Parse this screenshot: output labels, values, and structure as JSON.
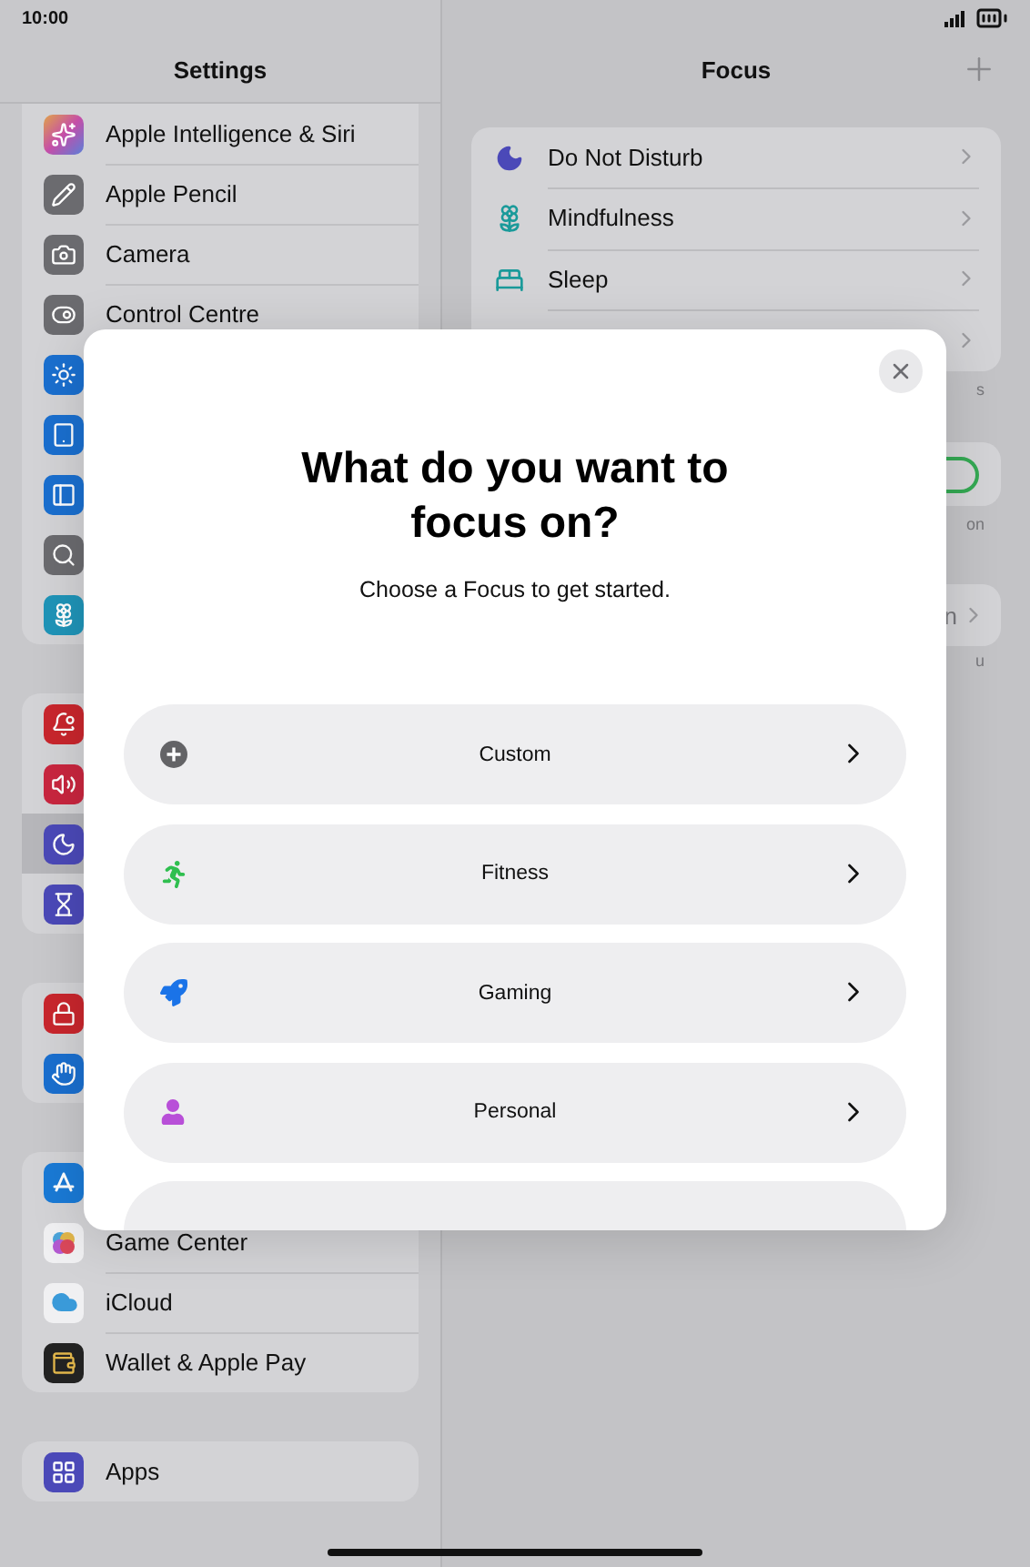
{
  "status_bar": {
    "time": "10:00"
  },
  "sidebar": {
    "title": "Settings",
    "groups": [
      {
        "items": [
          {
            "label": "Apple Intelligence & Siri",
            "selected": false
          },
          {
            "label": "Apple Pencil",
            "selected": false
          },
          {
            "label": "Camera",
            "selected": false
          },
          {
            "label": "Control Centre",
            "selected": false
          },
          {
            "selected": false
          },
          {
            "selected": false
          },
          {
            "selected": false
          },
          {
            "selected": false
          },
          {
            "selected": false
          }
        ]
      },
      {
        "items": [
          {
            "selected": false
          },
          {
            "selected": false
          },
          {
            "selected": true
          },
          {
            "selected": false
          }
        ]
      },
      {
        "items": [
          {
            "selected": false
          },
          {
            "selected": false
          }
        ]
      },
      {
        "items": [
          {
            "selected": false
          },
          {
            "label": "Game Center",
            "selected": false
          },
          {
            "label": "iCloud",
            "selected": false
          },
          {
            "label": "Wallet & Apple Pay",
            "selected": false
          }
        ]
      },
      {
        "items": [
          {
            "label": "Apps",
            "selected": false
          }
        ]
      }
    ]
  },
  "focus": {
    "title": "Focus",
    "modes": [
      {
        "kind": "mode",
        "label": "Do Not Disturb"
      },
      {
        "kind": "mode",
        "label": "Mindfulness"
      },
      {
        "kind": "mode",
        "label": "Sleep"
      },
      {
        "kind": "covered"
      }
    ],
    "note_1": "s",
    "toggle": {
      "on": true
    },
    "note_2": "on",
    "link_row": "n",
    "note_3": "u"
  },
  "modal": {
    "title": "What do you want to focus on?",
    "subtitle": "Choose a Focus to get started.",
    "options": [
      {
        "kind": "option",
        "label": "Custom"
      },
      {
        "kind": "option",
        "label": "Fitness"
      },
      {
        "kind": "option",
        "label": "Gaming"
      },
      {
        "kind": "option",
        "label": "Personal"
      },
      {
        "kind": "covered"
      }
    ]
  }
}
